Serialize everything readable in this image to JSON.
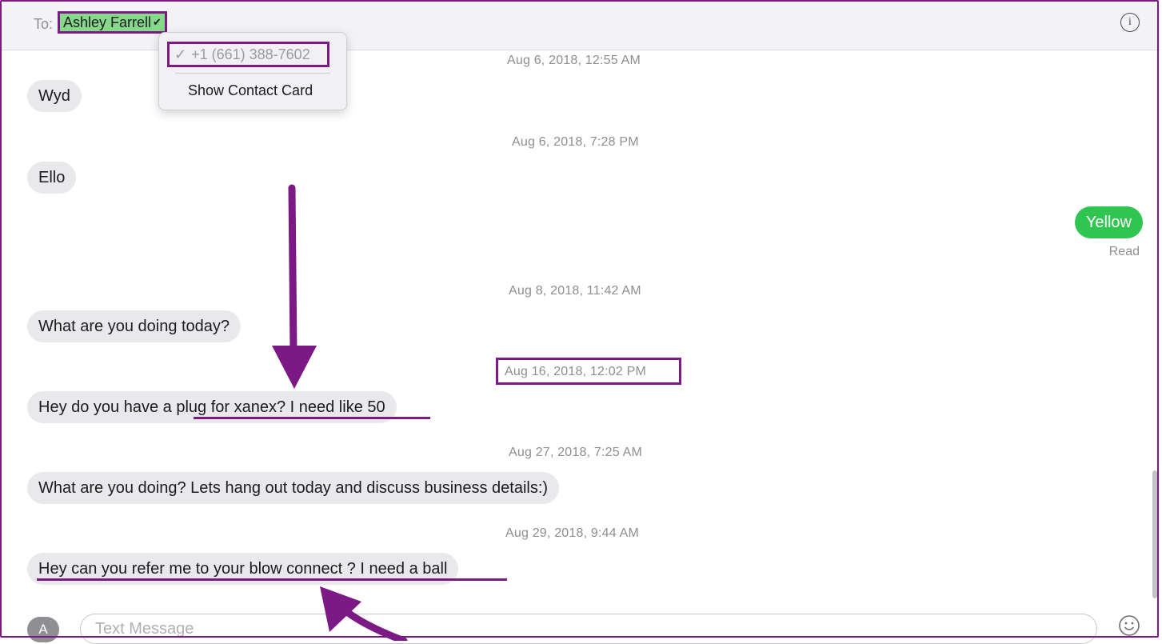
{
  "header": {
    "to_label": "To:",
    "recipient": "Ashley Farrell",
    "info_icon": "info-icon"
  },
  "dropdown": {
    "phone": "+1 (661) 388-7602",
    "show_contact_card": "Show Contact Card"
  },
  "conversation": [
    {
      "type": "timestamp",
      "text": "Aug 6, 2018, 12:55 AM"
    },
    {
      "type": "incoming",
      "text": "Wyd"
    },
    {
      "type": "timestamp",
      "text": "Aug 6, 2018, 7:28 PM"
    },
    {
      "type": "incoming",
      "text": "Ello"
    },
    {
      "type": "outgoing",
      "text": "Yellow",
      "status": "Read"
    },
    {
      "type": "timestamp",
      "text": "Aug 8, 2018, 11:42 AM"
    },
    {
      "type": "incoming",
      "text": "What are you doing today?"
    },
    {
      "type": "timestamp",
      "text": "Aug 16, 2018, 12:02 PM",
      "highlighted": true
    },
    {
      "type": "incoming",
      "text": "Hey do you have a plug for xanex? I need like 50"
    },
    {
      "type": "timestamp",
      "text": "Aug 27, 2018, 7:25 AM"
    },
    {
      "type": "incoming",
      "text": "What are you doing? Lets hang out today and discuss business details:)"
    },
    {
      "type": "timestamp",
      "text": "Aug 29, 2018, 9:44 AM"
    },
    {
      "type": "incoming",
      "text": "Hey can you refer me to your blow connect ? I need a ball"
    }
  ],
  "composer": {
    "placeholder": "Text Message",
    "apps_icon": "app-store-icon",
    "emoji_icon": "emoji-icon"
  },
  "colors": {
    "annotation": "#7b1a85",
    "outgoing_bubble": "#30c551",
    "incoming_bubble": "#e9e9eb",
    "recipient_highlight": "#86d98b"
  }
}
